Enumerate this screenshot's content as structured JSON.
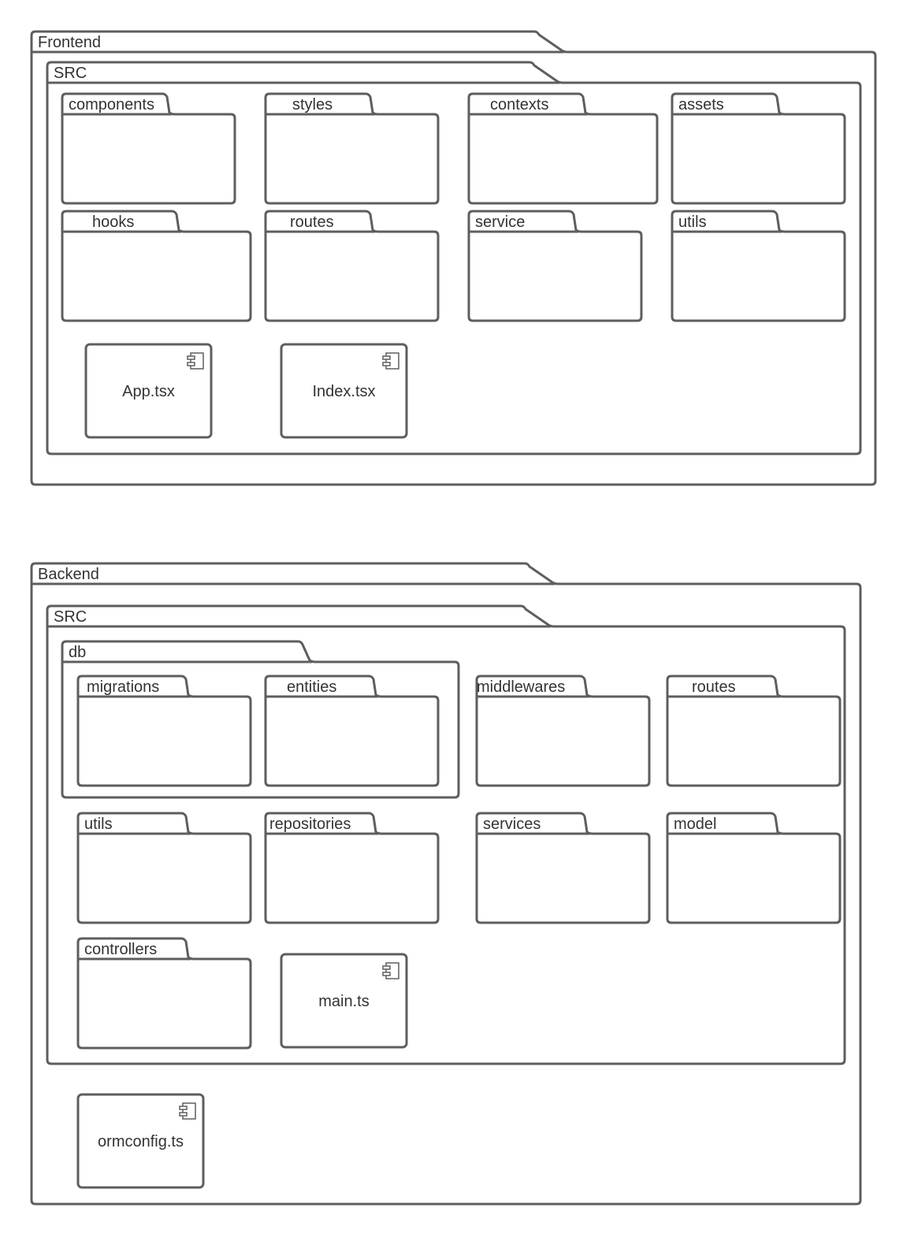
{
  "diagram": {
    "type": "UML package diagram",
    "colors": {
      "stroke": "#5e5e5e",
      "text": "#333333",
      "background": "#ffffff"
    },
    "frontend": {
      "label": "Frontend",
      "src": {
        "label": "SRC",
        "folders": [
          "components",
          "styles",
          "contexts",
          "assets",
          "hooks",
          "routes",
          "service",
          "utils"
        ],
        "components": [
          "App.tsx",
          "Index.tsx"
        ]
      }
    },
    "backend": {
      "label": "Backend",
      "src": {
        "label": "SRC",
        "db": {
          "label": "db",
          "folders": [
            "migrations",
            "entities"
          ]
        },
        "folders": [
          "middlewares",
          "routes",
          "utils",
          "repositories",
          "services",
          "model",
          "controllers"
        ],
        "components": [
          "main.ts"
        ]
      },
      "components": [
        "ormconfig.ts"
      ]
    },
    "icons": {
      "component": "uml-component-icon"
    }
  }
}
